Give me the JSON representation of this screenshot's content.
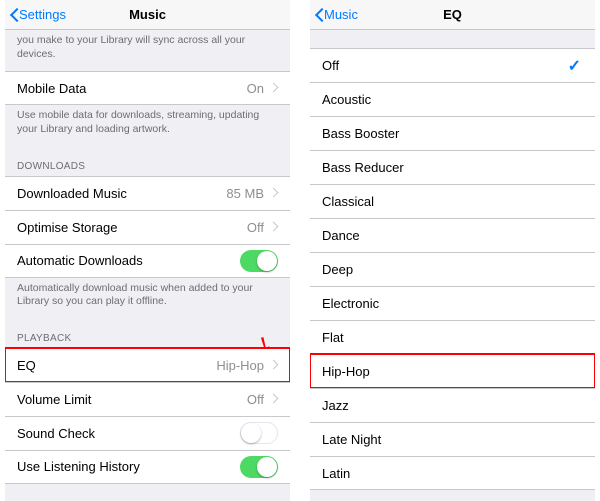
{
  "left": {
    "nav": {
      "back": "Settings",
      "title": "Music"
    },
    "topFooter": "you make to your Library will sync across all your devices.",
    "mobileData": {
      "label": "Mobile Data",
      "value": "On"
    },
    "mobileFooter": "Use mobile data for downloads, streaming, updating your Library and loading artwork.",
    "downloadsHeader": "DOWNLOADS",
    "downloadedMusic": {
      "label": "Downloaded Music",
      "value": "85 MB"
    },
    "optimise": {
      "label": "Optimise Storage",
      "value": "Off"
    },
    "autoDL": {
      "label": "Automatic Downloads"
    },
    "autoDLFooter": "Automatically download music when added to your Library so you can play it offline.",
    "playbackHeader": "PLAYBACK",
    "eq": {
      "label": "EQ",
      "value": "Hip-Hop"
    },
    "volLimit": {
      "label": "Volume Limit",
      "value": "Off"
    },
    "soundCheck": {
      "label": "Sound Check"
    },
    "history": {
      "label": "Use Listening History"
    }
  },
  "right": {
    "nav": {
      "back": "Music",
      "title": "EQ"
    },
    "items": [
      {
        "label": "Off",
        "selected": true
      },
      {
        "label": "Acoustic"
      },
      {
        "label": "Bass Booster"
      },
      {
        "label": "Bass Reducer"
      },
      {
        "label": "Classical"
      },
      {
        "label": "Dance"
      },
      {
        "label": "Deep"
      },
      {
        "label": "Electronic"
      },
      {
        "label": "Flat"
      },
      {
        "label": "Hip-Hop",
        "highlight": true
      },
      {
        "label": "Jazz"
      },
      {
        "label": "Late Night"
      },
      {
        "label": "Latin"
      }
    ]
  }
}
